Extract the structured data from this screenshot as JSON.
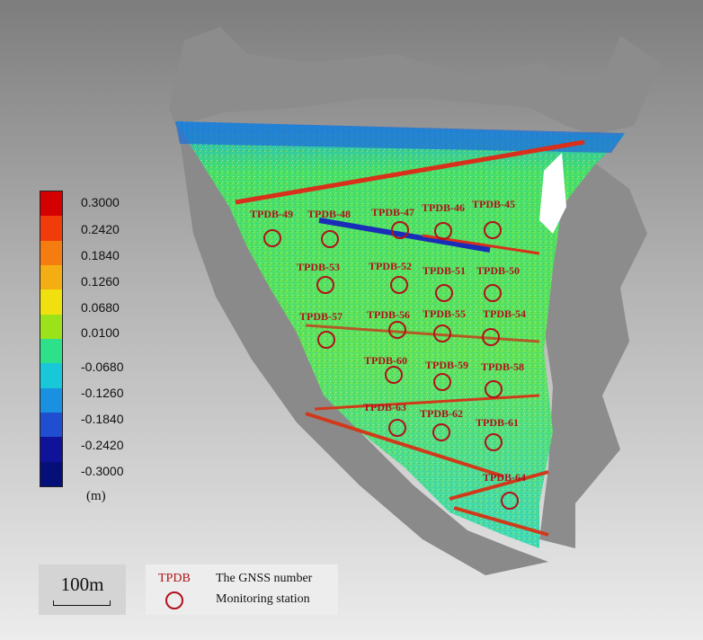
{
  "colorbar": {
    "ticks": [
      "0.3000",
      "0.2420",
      "0.1840",
      "0.1260",
      "0.0680",
      "0.0100",
      "-0.0680",
      "-0.1260",
      "-0.1840",
      "-0.2420",
      "-0.3000"
    ],
    "colors": [
      "#d40000",
      "#f03c0a",
      "#f57d10",
      "#f5ad14",
      "#f0e010",
      "#9be21a",
      "#2fe08a",
      "#18c8d8",
      "#1a90e0",
      "#1f4fd0",
      "#11129a",
      "#050f78"
    ],
    "unit": "(m)"
  },
  "stations": [
    {
      "id": "TPDB-49"
    },
    {
      "id": "TPDB-48"
    },
    {
      "id": "TPDB-47"
    },
    {
      "id": "TPDB-46"
    },
    {
      "id": "TPDB-45"
    },
    {
      "id": "TPDB-53"
    },
    {
      "id": "TPDB-52"
    },
    {
      "id": "TPDB-51"
    },
    {
      "id": "TPDB-50"
    },
    {
      "id": "TPDB-57"
    },
    {
      "id": "TPDB-56"
    },
    {
      "id": "TPDB-55"
    },
    {
      "id": "TPDB-54"
    },
    {
      "id": "TPDB-60"
    },
    {
      "id": "TPDB-59"
    },
    {
      "id": "TPDB-58"
    },
    {
      "id": "TPDB-63"
    },
    {
      "id": "TPDB-62"
    },
    {
      "id": "TPDB-61"
    },
    {
      "id": "TPDB-64"
    }
  ],
  "scale": {
    "label": "100m"
  },
  "legend": {
    "tpdb_label": "TPDB",
    "gnss_text": "The GNSS number",
    "station_text": "Monitoring station"
  },
  "colors": {
    "marker": "#b0121a",
    "terrain": "#8a8a8a"
  }
}
